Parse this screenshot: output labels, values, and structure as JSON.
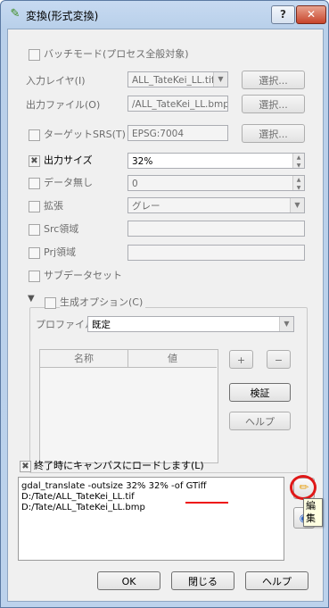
{
  "window": {
    "title": "変換(形式変換)",
    "help_icon": "question-icon",
    "close_icon": "close-icon"
  },
  "form": {
    "batch_mode": "バッチモード(プロセス全般対象)",
    "input_layer": {
      "label": "入力レイヤ(I)",
      "value": "ALL_TateKei_LL.tif",
      "button": "選択..."
    },
    "output_file": {
      "label": "出力ファイル(O)",
      "value": "/ALL_TateKei_LL.bmp",
      "button": "選択..."
    },
    "target_srs": {
      "label": "ターゲットSRS(T)",
      "value": "EPSG:7004",
      "button": "選択..."
    },
    "output_size": {
      "label": "出力サイズ",
      "value": "32%"
    },
    "no_data": {
      "label": "データ無し",
      "value": "0"
    },
    "expand": {
      "label": "拡張",
      "value": "グレー"
    },
    "src_area": {
      "label": "Src領域"
    },
    "prj_area": {
      "label": "Prj領域"
    },
    "subdataset": {
      "label": "サブデータセット"
    }
  },
  "creation_options": {
    "title": "生成オプション(C)",
    "profile_label": "プロファイル",
    "profile_value": "既定",
    "col_name": "名称",
    "col_value": "値",
    "add": "+",
    "remove": "−",
    "validate": "検証",
    "help": "ヘルプ"
  },
  "load_on_finish": "終了時にキャンバスにロードします(L)",
  "command": {
    "line1": "gdal_translate -outsize 32% 32% -of GTiff",
    "line2": "D:/Tate/ALL_TateKei_LL.tif",
    "line3": "D:/Tate/ALL_TateKei_LL.bmp"
  },
  "edit_tooltip": "編集",
  "footer": {
    "ok": "OK",
    "close": "閉じる",
    "help": "ヘルプ"
  }
}
